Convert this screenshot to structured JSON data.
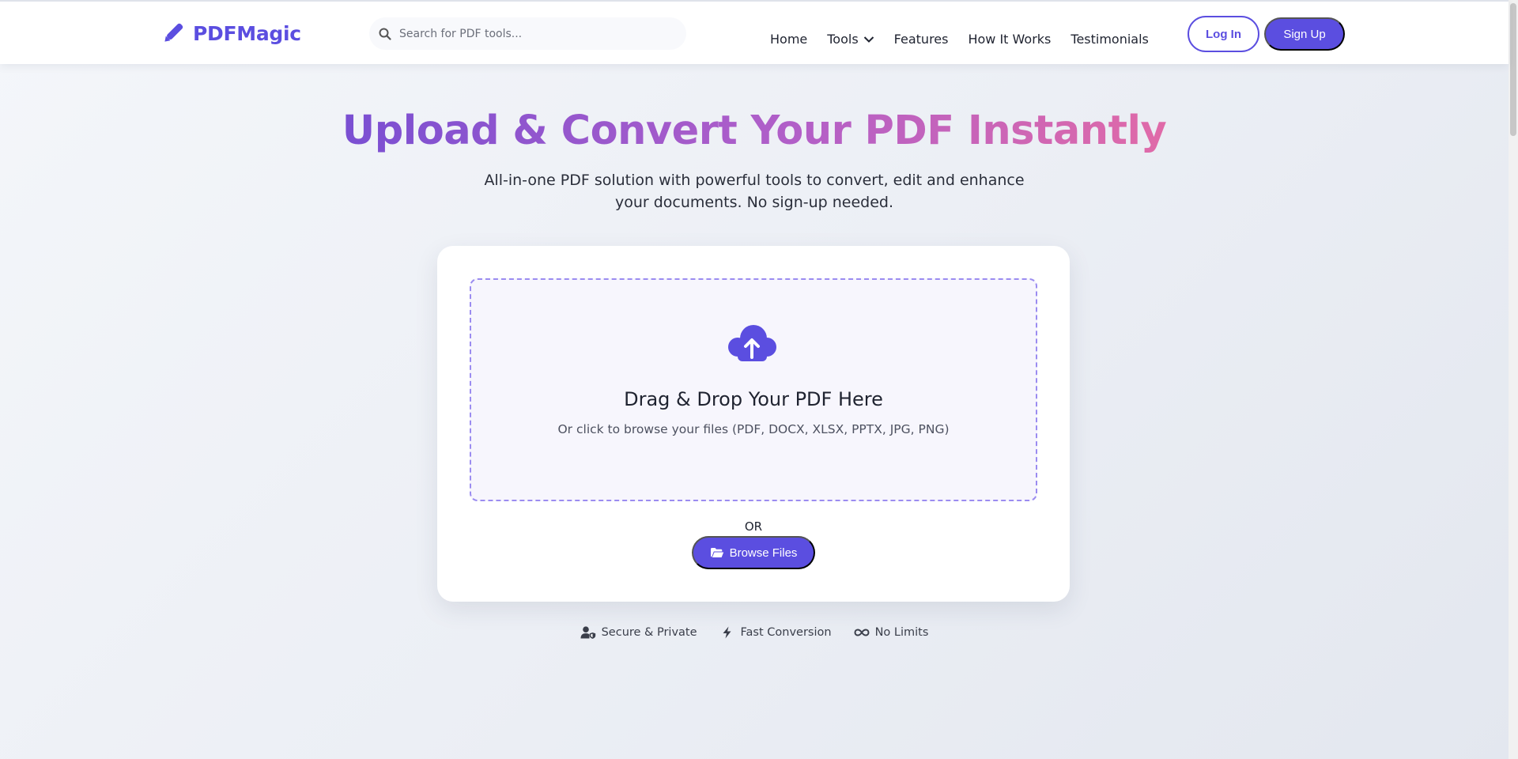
{
  "nav": {
    "logo_text": "PDFMagic",
    "search_placeholder": "Search for PDF tools...",
    "links": [
      "Home",
      "Tools",
      "Features",
      "How It Works",
      "Testimonials"
    ],
    "login_label": "Log In",
    "signup_label": "Sign Up"
  },
  "hero": {
    "title": "Upload & Convert Your PDF Instantly",
    "subtitle": "All-in-one PDF solution with powerful tools to convert, edit and enhance your documents. No sign-up needed."
  },
  "upload": {
    "icon": "cloud-upload-icon",
    "title": "Drag & Drop Your PDF Here",
    "subtitle": "Or click to browse your files (PDF, DOCX, XLSX, PPTX, JPG, PNG)",
    "or_text": "OR",
    "browse_label": "Browse Files"
  },
  "features": [
    {
      "icon": "user-shield-icon",
      "label": "Secure & Private"
    },
    {
      "icon": "bolt-icon",
      "label": "Fast Conversion"
    },
    {
      "icon": "infinity-icon",
      "label": "No Limits"
    }
  ],
  "colors": {
    "brand": "#5b4ee0",
    "title_gradient_start": "#7a4fd2",
    "title_gradient_end": "#e06aa8",
    "dropzone_border": "#9b8cf0"
  }
}
